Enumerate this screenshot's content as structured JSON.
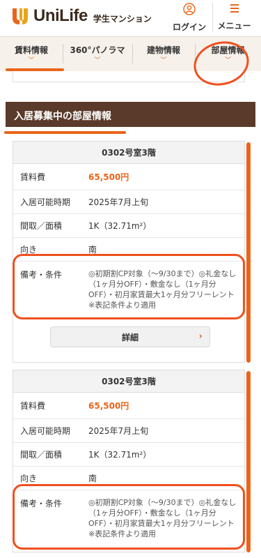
{
  "header": {
    "logo_text": "UniLife",
    "logo_sub": "学生マンション",
    "login_label": "ログイン",
    "menu_label": "メニュー"
  },
  "tabs": [
    {
      "label": "賃料情報",
      "active": true
    },
    {
      "label": "360°パノラマ"
    },
    {
      "label": "建物情報"
    },
    {
      "label": "部屋情報",
      "circled": true
    }
  ],
  "section_title": "入居募集中の部屋情報",
  "cards": [
    {
      "title": "0302号室3階",
      "rows": [
        {
          "key": "賃料費",
          "value": "65,500円"
        },
        {
          "key": "入居可能時期",
          "value": "2025年7月上旬"
        },
        {
          "key": "間取／面積",
          "value": "1K（32.71m²）"
        },
        {
          "key": "向き",
          "value": "南"
        },
        {
          "key": "備考・条件",
          "value": "◎初期割CP対象（〜9/30まで）◎礼金なし（1ヶ月分OFF）・敷金なし（1ヶ月分OFF）・初月家賃最大1ヶ月分フリーレント ※表記条件より適用"
        }
      ],
      "detail_label": "詳細"
    },
    {
      "title": "0302号室3階",
      "rows": [
        {
          "key": "賃料費",
          "value": "65,500円"
        },
        {
          "key": "入居可能時期",
          "value": "2025年7月上旬"
        },
        {
          "key": "間取／面積",
          "value": "1K（32.71m²）"
        },
        {
          "key": "向き",
          "value": "南"
        },
        {
          "key": "備考・条件",
          "value": "◎初期割CP対象（〜9/30まで）◎礼金なし（1ヶ月分OFF）・敷金なし（1ヶ月分OFF）・初月家賃最大1ヶ月分フリーレント ※表記条件より適用"
        }
      ]
    }
  ],
  "colors": {
    "accent": "#e9651a",
    "section_bg": "#5a3a2a",
    "highlight": "#f0501e"
  },
  "icons": {
    "login": "user-icon",
    "menu": "hamburger-icon",
    "tab_chevron": "chevron-down-icon",
    "detail_arrow": "chevron-right-icon"
  }
}
